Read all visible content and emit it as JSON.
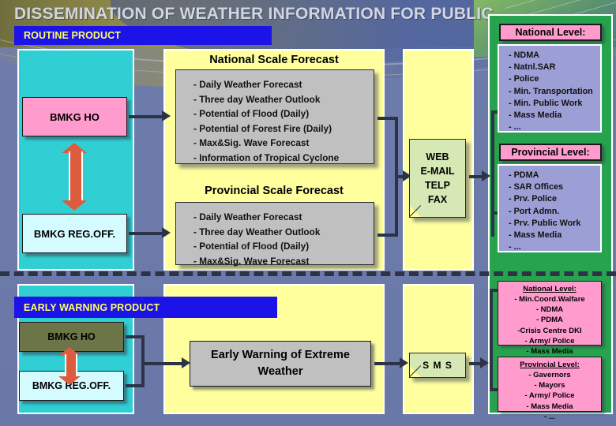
{
  "title": "DISSEMINATION OF WEATHER INFORMATION FOR PUBLIC",
  "banners": {
    "routine": "ROUTINE PRODUCT",
    "early": "EARLY WARNING PRODUCT"
  },
  "sources": {
    "routine": {
      "ho": "BMKG HO",
      "reg": "BMKG REG.OFF."
    },
    "early": {
      "ho": "BMKG HO",
      "reg": "BMKG REG.OFF."
    }
  },
  "forecasts": {
    "national": {
      "caption": "National Scale Forecast",
      "items": [
        "- Daily Weather Forecast",
        "- Three day Weather Outlook",
        "-  Potential of Flood (Daily)",
        "- Potential of Forest Fire (Daily)",
        "- Max&Sig. Wave Forecast",
        "- Information of Tropical Cyclone"
      ]
    },
    "provincial": {
      "caption": "Provincial Scale Forecast",
      "items": [
        "- Daily Weather Forecast",
        "- Three day Weather Outlook",
        "-  Potential of Flood (Daily)",
        "- Max&Sig. Wave Forecast"
      ]
    }
  },
  "channels": {
    "routine": [
      "WEB",
      "E-MAIL",
      "TELP",
      "FAX"
    ],
    "early": "S M S"
  },
  "early_warning_product": "Early Warning of Extreme Weather",
  "recipients": {
    "routine_national": {
      "header": "National Level:",
      "items": [
        "- NDMA",
        "- Natnl.SAR",
        "- Police",
        "- Min. Transportation",
        "- Min. Public Work",
        "- Mass Media",
        "- ..."
      ]
    },
    "routine_provincial": {
      "header": "Provincial Level:",
      "items": [
        "- PDMA",
        "- SAR Offices",
        "- Prv. Police",
        "- Port Admn.",
        "- Prv. Public Work",
        "- Mass Media",
        "- ..."
      ]
    },
    "early_national": {
      "header": "National Level:",
      "items": [
        "- Min.Coord.Walfare",
        "- NDMA",
        "- PDMA",
        "-Crisis Centre DKI",
        "- Army/ Police",
        "- Mass Media",
        "- ..."
      ]
    },
    "early_provincial": {
      "header": "Provincial Level:",
      "items": [
        "- Gavernors",
        "-  Mayors",
        "- Army/ Police",
        "- Mass Media",
        "- ..."
      ]
    }
  },
  "colors": {
    "banner_bg": "#1b13e8",
    "banner_text": "#ffff66",
    "cyan_panel": "#2fcfd3",
    "yellow_panel": "#ffff9e",
    "green_panel": "#27a34f",
    "pink_box": "#ff9ccd",
    "gray_card": "#c0c0c0",
    "doc_box": "#d6e8b4",
    "lilac_body": "#9c9ed6",
    "arrow": "#2d3347",
    "dbl_arrow": "#dd5c3e"
  }
}
